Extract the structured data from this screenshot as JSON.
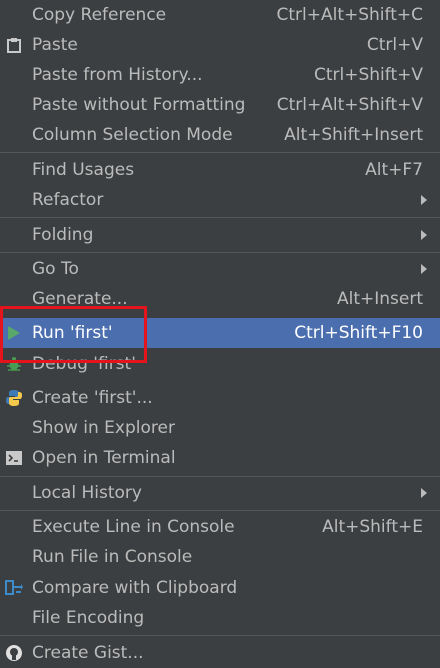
{
  "menu": {
    "items": [
      {
        "label": "Copy Reference",
        "shortcut": "Ctrl+Alt+Shift+C"
      },
      {
        "label": "Paste",
        "shortcut": "Ctrl+V",
        "icon": "clipboard-icon"
      },
      {
        "label": "Paste from History...",
        "shortcut": "Ctrl+Shift+V"
      },
      {
        "label": "Paste without Formatting",
        "shortcut": "Ctrl+Alt+Shift+V"
      },
      {
        "label": "Column Selection Mode",
        "shortcut": "Alt+Shift+Insert"
      },
      {
        "label": "Find Usages",
        "shortcut": "Alt+F7"
      },
      {
        "label": "Refactor",
        "submenu": true
      },
      {
        "label": "Folding",
        "submenu": true
      },
      {
        "label": "Go To",
        "submenu": true
      },
      {
        "label": "Generate...",
        "shortcut": "Alt+Insert"
      },
      {
        "label": "Run 'first'",
        "shortcut": "Ctrl+Shift+F10",
        "icon": "run-icon",
        "selected": true
      },
      {
        "label": "Debug 'first'",
        "icon": "debug-icon"
      },
      {
        "label": "Create 'first'...",
        "icon": "python-icon"
      },
      {
        "label": "Show in Explorer"
      },
      {
        "label": "Open in Terminal",
        "icon": "terminal-icon"
      },
      {
        "label": "Local History",
        "submenu": true
      },
      {
        "label": "Execute Line in Console",
        "shortcut": "Alt+Shift+E"
      },
      {
        "label": "Run File in Console"
      },
      {
        "label": "Compare with Clipboard",
        "icon": "compare-icon"
      },
      {
        "label": "File Encoding"
      },
      {
        "label": "Create Gist...",
        "icon": "github-icon"
      }
    ]
  },
  "colors": {
    "background": "#3c3f41",
    "selected": "#4b6eaf",
    "text": "#bbbbbb",
    "annotation_box": "#e3141b"
  }
}
